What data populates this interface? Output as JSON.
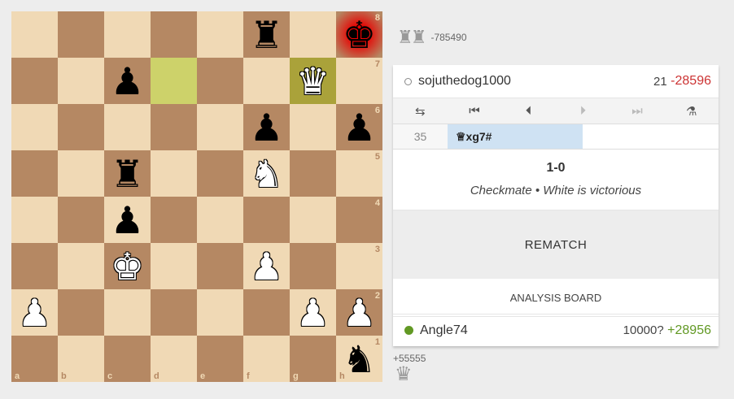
{
  "board": {
    "ranks": [
      "8",
      "7",
      "6",
      "5",
      "4",
      "3",
      "2",
      "1"
    ],
    "files": [
      "a",
      "b",
      "c",
      "d",
      "e",
      "f",
      "g",
      "h"
    ],
    "pieces": [
      {
        "square": "f8",
        "piece": "rook",
        "color": "black",
        "glyph": "♜"
      },
      {
        "square": "h8",
        "piece": "king",
        "color": "black",
        "glyph": "♚"
      },
      {
        "square": "c7",
        "piece": "pawn",
        "color": "black",
        "glyph": "♟"
      },
      {
        "square": "g7",
        "piece": "queen",
        "color": "white",
        "glyph": "♛"
      },
      {
        "square": "f6",
        "piece": "pawn",
        "color": "black",
        "glyph": "♟"
      },
      {
        "square": "h6",
        "piece": "pawn",
        "color": "black",
        "glyph": "♟"
      },
      {
        "square": "c5",
        "piece": "rook",
        "color": "black",
        "glyph": "♜"
      },
      {
        "square": "f5",
        "piece": "knight",
        "color": "white",
        "glyph": "♞"
      },
      {
        "square": "c4",
        "piece": "pawn",
        "color": "black",
        "glyph": "♟"
      },
      {
        "square": "c3",
        "piece": "king",
        "color": "white",
        "glyph": "♚"
      },
      {
        "square": "f3",
        "piece": "pawn",
        "color": "white",
        "glyph": "♟"
      },
      {
        "square": "a2",
        "piece": "pawn",
        "color": "white",
        "glyph": "♟"
      },
      {
        "square": "g2",
        "piece": "pawn",
        "color": "white",
        "glyph": "♟"
      },
      {
        "square": "h2",
        "piece": "pawn",
        "color": "white",
        "glyph": "♟"
      },
      {
        "square": "h1",
        "piece": "knight",
        "color": "black",
        "glyph": "♞"
      }
    ],
    "last_move_squares": [
      "d7",
      "g7"
    ],
    "check_square": "h8",
    "colors": {
      "light": "#f0d9b5",
      "dark": "#b58863",
      "highlight": "#cdd26a",
      "check": "#e70000"
    }
  },
  "material_top": {
    "pieces": "♜♜",
    "diff": "-785490"
  },
  "material_bottom": {
    "diff": "+55555",
    "pieces": "♛"
  },
  "player_top": {
    "name": "sojuthedog1000",
    "rating": "21",
    "diff": "-28596",
    "online": false
  },
  "controls": [
    {
      "name": "flip-board-icon",
      "glyph": "⇆",
      "enabled": true
    },
    {
      "name": "first-move-icon",
      "glyph": "⏮",
      "enabled": true
    },
    {
      "name": "previous-move-icon",
      "glyph": "⏴",
      "enabled": true
    },
    {
      "name": "next-move-icon",
      "glyph": "⏵",
      "enabled": false
    },
    {
      "name": "last-move-icon",
      "glyph": "⏭",
      "enabled": false
    },
    {
      "name": "analysis-icon",
      "glyph": "⚗",
      "enabled": true
    }
  ],
  "moves": {
    "index": "35",
    "move": "♕xg7#"
  },
  "result": {
    "score": "1-0",
    "status": "Checkmate • White is victorious"
  },
  "rematch_label": "REMATCH",
  "analysis_label": "ANALYSIS BOARD",
  "player_bottom": {
    "name": "Angle74",
    "rating": "10000?",
    "diff": "+28956",
    "online": true
  }
}
